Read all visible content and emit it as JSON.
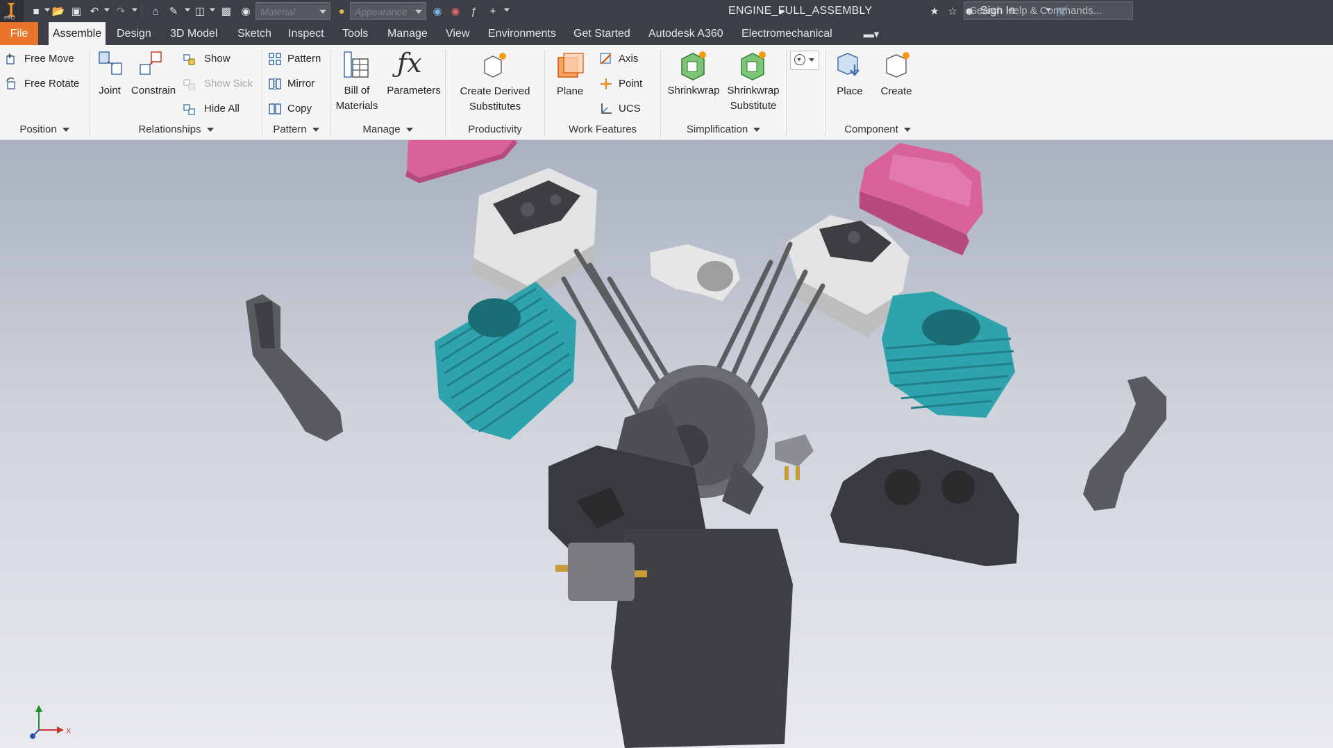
{
  "app": {
    "title": "ENGINE_FULL_ASSEMBLY",
    "logo_text": "PRO",
    "material_placeholder": "Material",
    "appearance_placeholder": "Appearance",
    "search_placeholder": "Search Help & Commands...",
    "sign_in": "Sign In"
  },
  "tabs": [
    {
      "label": "File"
    },
    {
      "label": "Assemble"
    },
    {
      "label": "Design"
    },
    {
      "label": "3D Model"
    },
    {
      "label": "Sketch"
    },
    {
      "label": "Inspect"
    },
    {
      "label": "Tools"
    },
    {
      "label": "Manage"
    },
    {
      "label": "View"
    },
    {
      "label": "Environments"
    },
    {
      "label": "Get Started"
    },
    {
      "label": "Autodesk A360"
    },
    {
      "label": "Electromechanical"
    }
  ],
  "ribbon": {
    "position": {
      "title": "Position",
      "free_move": "Free Move",
      "free_rotate": "Free Rotate"
    },
    "relationships": {
      "title": "Relationships",
      "joint": "Joint",
      "constrain": "Constrain",
      "show": "Show",
      "show_sick": "Show Sick",
      "hide_all": "Hide All"
    },
    "pattern": {
      "title": "Pattern",
      "pattern": "Pattern",
      "mirror": "Mirror",
      "copy": "Copy"
    },
    "manage": {
      "title": "Manage",
      "bom_line1": "Bill of",
      "bom_line2": "Materials",
      "parameters": "Parameters"
    },
    "productivity": {
      "title": "Productivity",
      "cds_line1": "Create Derived",
      "cds_line2": "Substitutes"
    },
    "work_features": {
      "title": "Work Features",
      "plane": "Plane",
      "axis": "Axis",
      "point": "Point",
      "ucs": "UCS"
    },
    "simplification": {
      "title": "Simplification",
      "shrinkwrap": "Shrinkwrap",
      "sws_line1": "Shrinkwrap",
      "sws_line2": "Substitute"
    },
    "component": {
      "title": "Component",
      "place": "Place",
      "create": "Create"
    }
  },
  "triad": {
    "x_label": "X"
  },
  "colors": {
    "accent_file_tab": "#e8752a",
    "title_bar": "#3c3f45",
    "valve_cover": "#d9629a",
    "cylinder": "#2fa3ad",
    "metal_dark": "#4a4b4e",
    "metal_light": "#e3e3e3"
  }
}
